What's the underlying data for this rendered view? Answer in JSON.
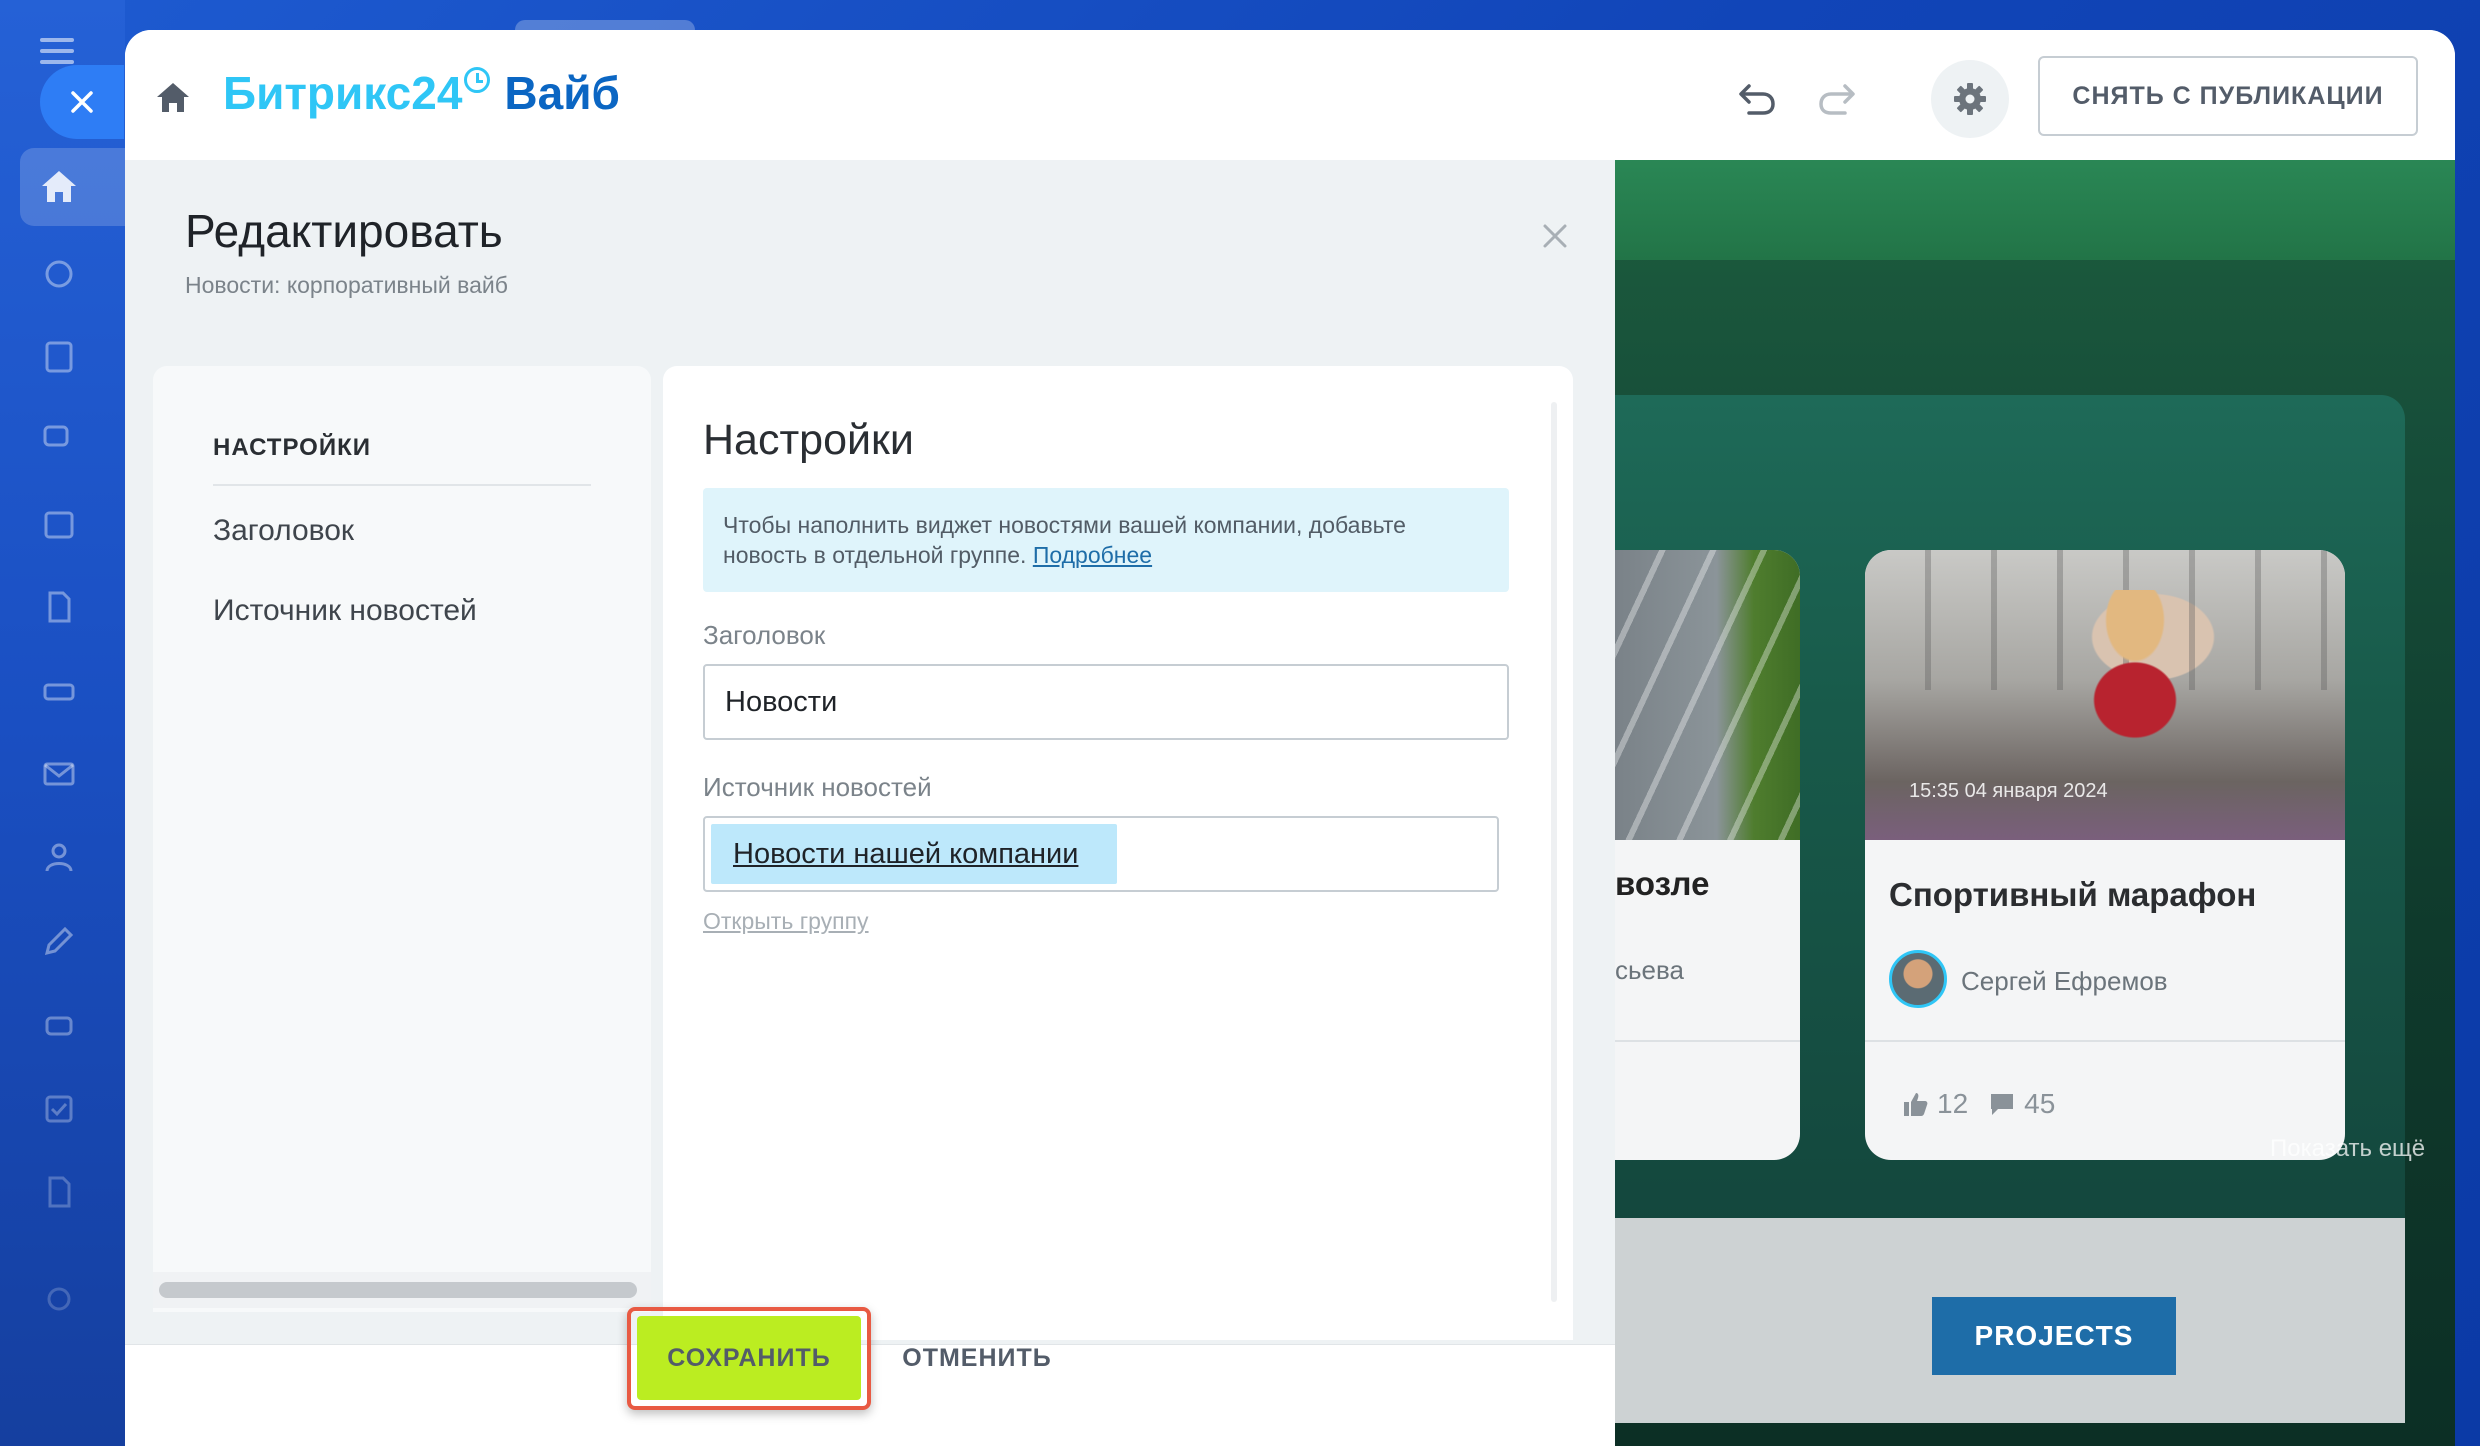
{
  "brand": {
    "name_part1": "Битрикс24",
    "name_part2": "Вайб"
  },
  "toolbar": {
    "unpublish_label": "СНЯТЬ С ПУБЛИКАЦИИ"
  },
  "editor": {
    "title": "Редактировать",
    "subtitle": "Новости: корпоративный вайб",
    "nav": {
      "heading": "НАСТРОЙКИ",
      "items": [
        {
          "label": "Заголовок"
        },
        {
          "label": "Источник новостей"
        }
      ]
    },
    "form": {
      "title": "Настройки",
      "info_text": "Чтобы наполнить виджет новостями вашей компании, добавьте новость в отдельной группе.",
      "info_link": "Подробнее",
      "title_field_label": "Заголовок",
      "title_field_value": "Новости",
      "source_field_label": "Источник новостей",
      "source_value": "Новости нашей компании",
      "open_group_link": "Открыть группу"
    },
    "footer": {
      "save_label": "СОХРАНИТЬ",
      "cancel_label": "ОТМЕНИТЬ"
    }
  },
  "preview": {
    "partial_card": {
      "title_fragment": "возле",
      "author_fragment": "сьева"
    },
    "card": {
      "date": "15:35 04 января 2024",
      "title": "Спортивный марафон",
      "author": "Сергей Ефремов",
      "likes": "12",
      "comments": "45"
    },
    "show_more": "Показать ещё",
    "projects_button": "PROJECTS"
  },
  "colors": {
    "accent": "#2fc6f6",
    "brand_dark": "#0b66c3",
    "save_green": "#bbed21",
    "highlight_red": "#e85a43",
    "background_blue": "#1145b8"
  }
}
